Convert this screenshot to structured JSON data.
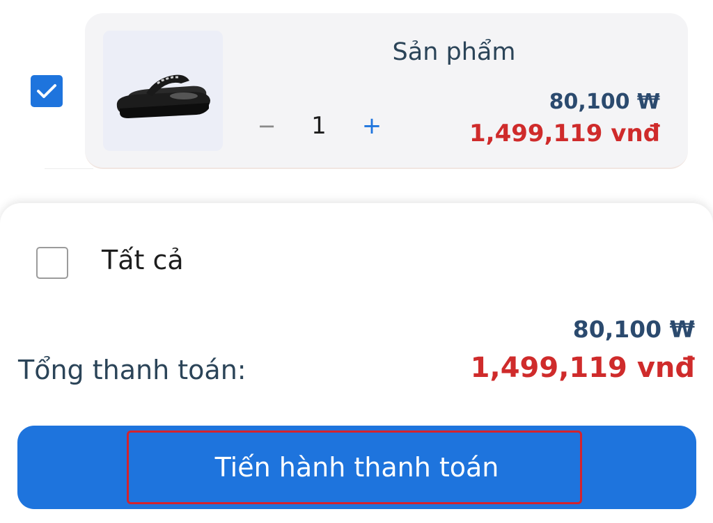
{
  "cart_item": {
    "checked": true,
    "name": "Sản phẩm",
    "quantity": "1",
    "minus_symbol": "−",
    "plus_symbol": "+",
    "price_krw": "80,100 ₩",
    "price_vnd": "1,499,119 vnđ",
    "thumbnail_icon": "sandal-image"
  },
  "footer": {
    "select_all_label": "Tất cả",
    "select_all_checked": false,
    "total_label": "Tổng thanh toán:",
    "total_krw": "80,100 ₩",
    "total_vnd": "1,499,119 vnđ",
    "checkout_label": "Tiến hành thanh toán"
  },
  "colors": {
    "accent": "#1e74dd",
    "price_red": "#cf2b2b",
    "price_navy": "#2b4a6e",
    "highlight": "#d4232d"
  }
}
